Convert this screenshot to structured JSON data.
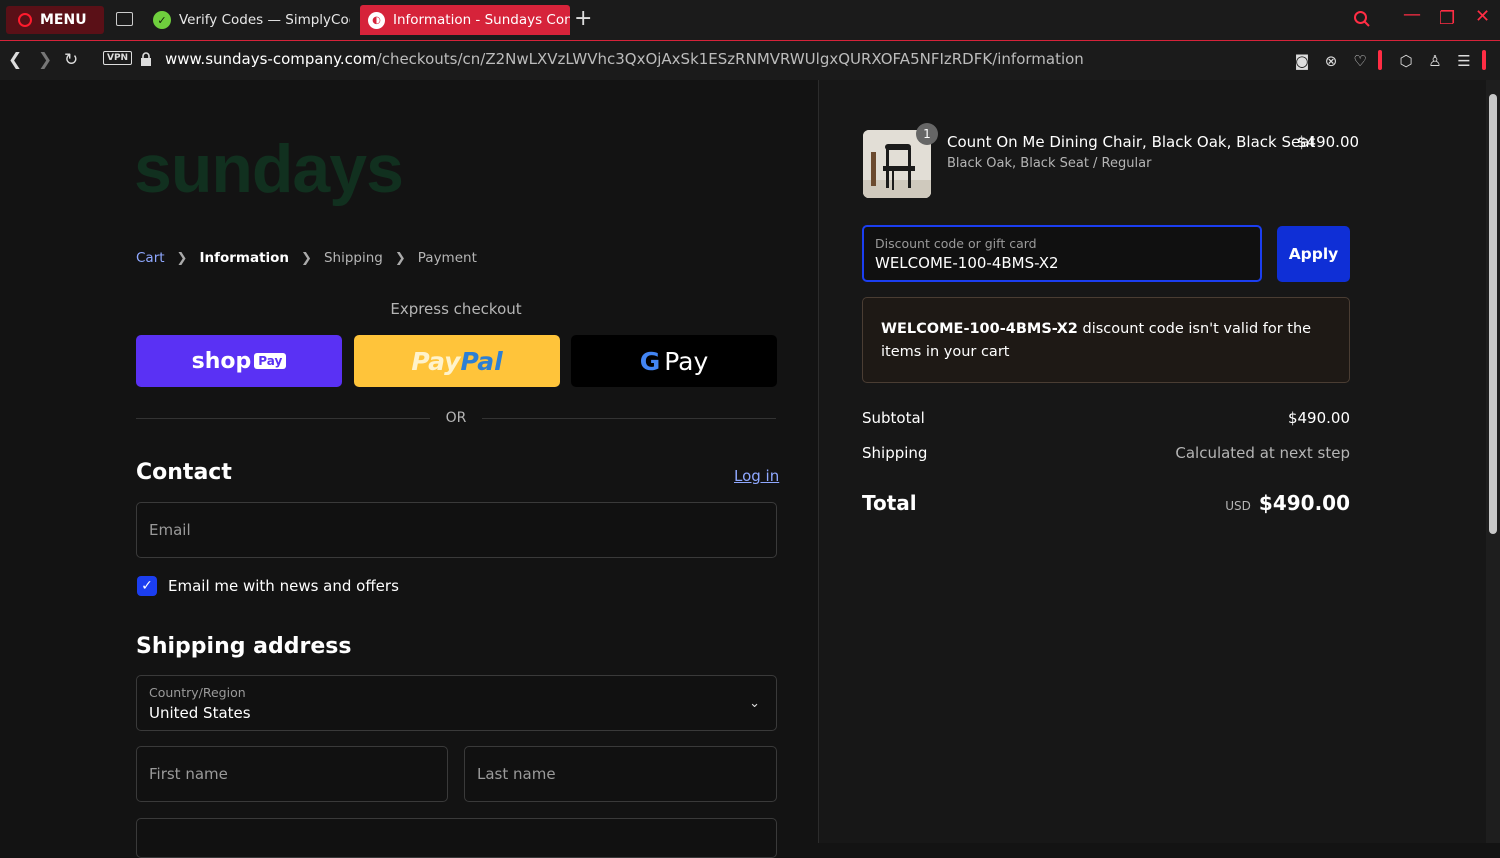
{
  "browser": {
    "menu_label": "MENU",
    "tabs": [
      {
        "title": "Verify Codes — SimplyCodes"
      },
      {
        "title": "Information - Sundays Company"
      }
    ],
    "url_domain": "www.sundays-company.com",
    "url_path": "/checkouts/cn/Z2NwLXVzLWVhc3QxOjAxSk1ESzRNMVRWUlgxQURXOFA5NFIzRDFK/information",
    "vpn_label": "VPN"
  },
  "page": {
    "logo": "sundays",
    "breadcrumb": [
      "Cart",
      "Information",
      "Shipping",
      "Payment"
    ],
    "express_checkout": "Express checkout",
    "shop_label": "shop",
    "shop_badge": "Pay",
    "paypal_a": "Pay",
    "paypal_b": "Pal",
    "gpay_g": "G",
    "gpay_label": "Pay",
    "or_label": "OR",
    "contact_heading": "Contact",
    "login_link": "Log in",
    "email_placeholder": "Email",
    "news_checkbox_label": "Email me with news and offers",
    "shipping_heading": "Shipping address",
    "country_label": "Country/Region",
    "country_value": "United States",
    "first_name_placeholder": "First name",
    "last_name_placeholder": "Last name"
  },
  "summary": {
    "item": {
      "quantity": "1",
      "name": "Count On Me Dining Chair, Black Oak, Black Seat",
      "variant": "Black Oak, Black Seat / Regular",
      "price": "$490.00"
    },
    "discount_label": "Discount code or gift card",
    "discount_value": "WELCOME-100-4BMS-X2",
    "apply_label": "Apply",
    "error_code": "WELCOME-100-4BMS-X2",
    "error_text": " discount code isn't valid for the items in your cart",
    "subtotal_label": "Subtotal",
    "subtotal_value": "$490.00",
    "shipping_label": "Shipping",
    "shipping_value": "Calculated at next step",
    "total_label": "Total",
    "currency": "USD",
    "total_value": "$490.00"
  },
  "colors": {
    "accent_blue": "#1b3ef0",
    "shop_purple": "#5a31f4",
    "paypal_yellow": "#ffc43a",
    "opera_red": "#d6233a"
  }
}
